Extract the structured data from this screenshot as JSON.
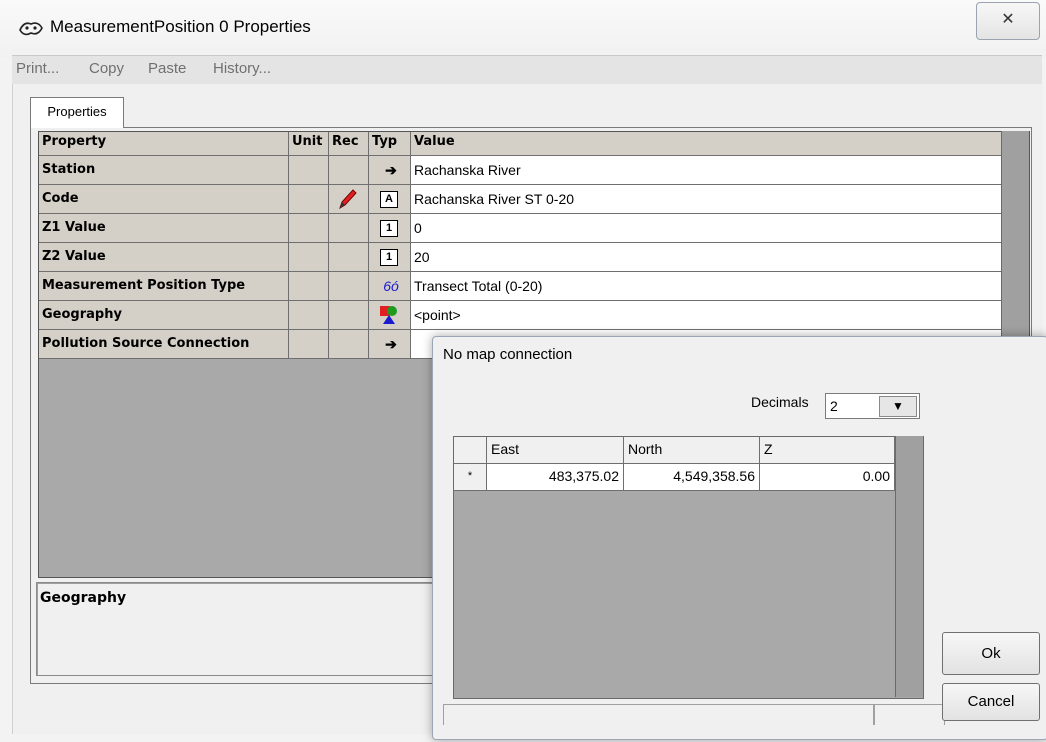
{
  "window": {
    "title": "MeasurementPosition 0 Properties",
    "close_glyph": "✕"
  },
  "menu": [
    "Print...",
    "Copy",
    "Paste",
    "History..."
  ],
  "tabs": [
    "Properties"
  ],
  "grid": {
    "headers": {
      "property": "Property",
      "unit": "Unit",
      "rec": "Rec",
      "type": "Typ",
      "value": "Value"
    },
    "rows": [
      {
        "property": "Station",
        "rec_icon": "",
        "type_icon": "arrow-icon",
        "type_glyph": "➔",
        "value": "Rachanska River"
      },
      {
        "property": "Code",
        "rec_icon": "pencil-icon",
        "type_icon": "text-icon",
        "type_glyph": "A",
        "value": "Rachanska River ST 0-20"
      },
      {
        "property": "Z1 Value",
        "rec_icon": "",
        "type_icon": "number-icon",
        "type_glyph": "1",
        "value": "0"
      },
      {
        "property": "Z2 Value",
        "rec_icon": "",
        "type_icon": "number-icon",
        "type_glyph": "1",
        "value": "20"
      },
      {
        "property": "Measurement Position Type",
        "rec_icon": "",
        "type_icon": "glasses-icon",
        "type_glyph": "6ó",
        "value": "Transect Total (0-20)"
      },
      {
        "property": "Geography",
        "rec_icon": "",
        "type_icon": "shapes-icon",
        "type_glyph": "",
        "value": "<point>"
      },
      {
        "property": "Pollution Source Connection",
        "rec_icon": "",
        "type_icon": "arrow-icon",
        "type_glyph": "➔",
        "value": ""
      }
    ]
  },
  "description": {
    "title": "Geography"
  },
  "dialog": {
    "title": "No map connection",
    "decimals_label": "Decimals",
    "decimals_value": "2",
    "dropdown_glyph": "▼",
    "columns": [
      "East",
      "North",
      "Z"
    ],
    "row_marker": "*",
    "row": {
      "east": "483,375.02",
      "north": "4,549,358.56",
      "z": "0.00"
    },
    "ok_label": "Ok",
    "cancel_label": "Cancel"
  },
  "colors": {
    "grid_bg": "#a9a9a9",
    "header_bg": "#d4d0c8",
    "pencil": "#e02020"
  }
}
